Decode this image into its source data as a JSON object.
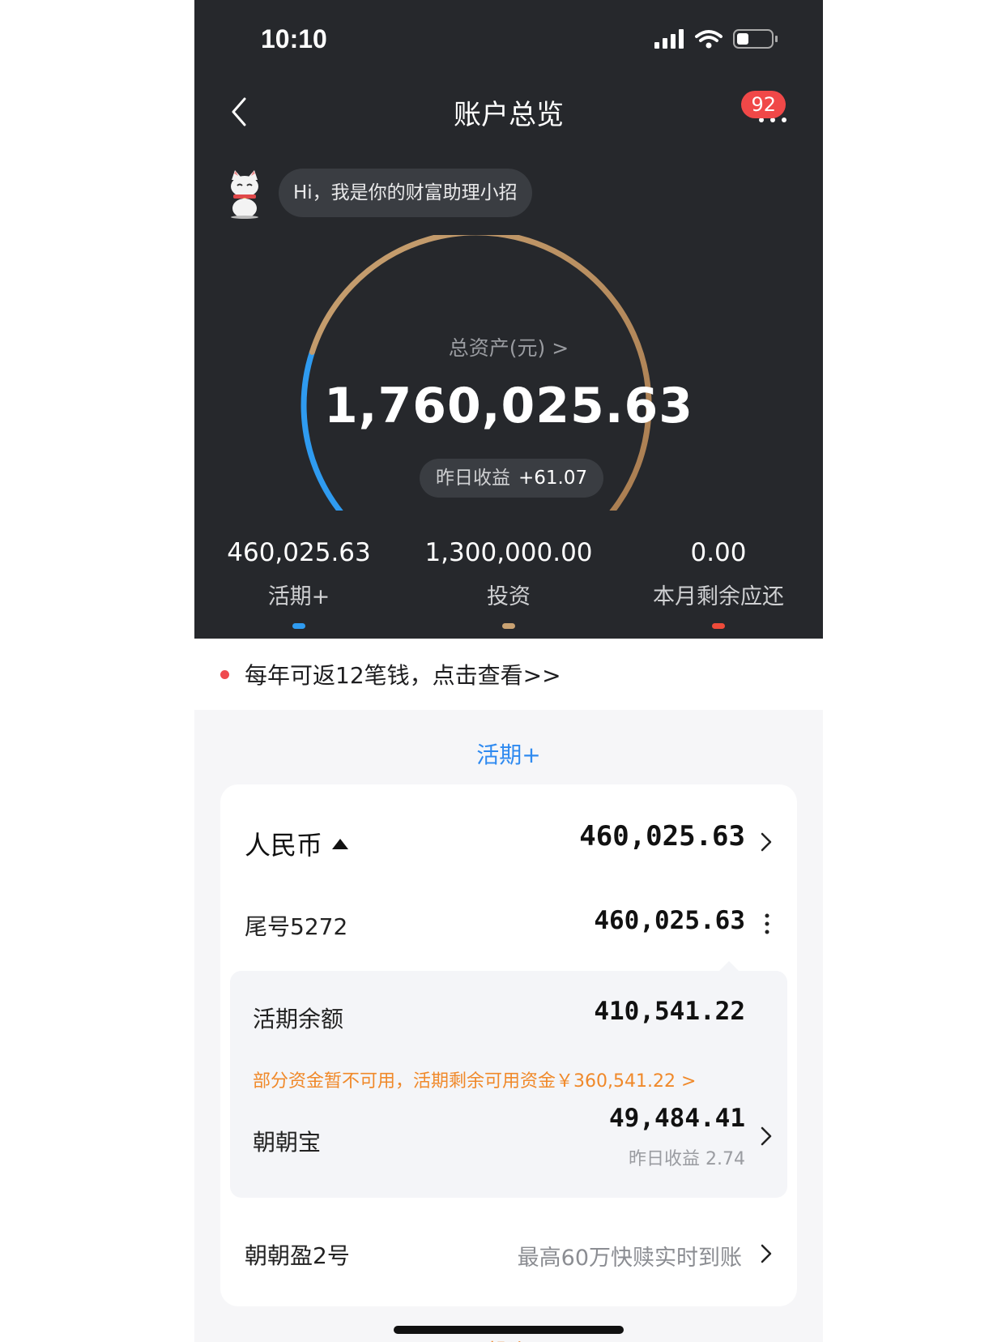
{
  "status_bar": {
    "time": "10:10"
  },
  "nav": {
    "title": "账户总览",
    "badge": "92"
  },
  "assistant": {
    "greeting": "Hi，我是你的财富助理小招"
  },
  "summary": {
    "total_label": "总资产(元) >",
    "total_value": "1,760,025.63",
    "yesterday_label": "昨日收益",
    "yesterday_value": "+61.07",
    "gauge_blue_fraction": 0.2614,
    "gauge_gold_fraction": 0.7386
  },
  "stats": [
    {
      "value": "460,025.63",
      "label": "活期+",
      "color": "#2f9bf0"
    },
    {
      "value": "1,300,000.00",
      "label": "投资",
      "color": "#c9a272"
    },
    {
      "value": "0.00",
      "label": "本月剩余应还",
      "color": "#ee4b3a"
    }
  ],
  "notice": {
    "text": "每年可返12笔钱，点击查看>>"
  },
  "section": {
    "title": "活期+"
  },
  "currency": {
    "name": "人民币",
    "amount": "460,025.63"
  },
  "account": {
    "name": "尾号5272",
    "amount": "460,025.63"
  },
  "detail": {
    "balance_label": "活期余额",
    "balance_value": "410,541.22",
    "warning": "部分资金暂不可用，活期剩余可用资金￥360,541.22 >",
    "product_name": "朝朝宝",
    "product_amount": "49,484.41",
    "product_yesterday": "昨日收益 2.74"
  },
  "product2": {
    "name": "朝朝盈2号",
    "desc": "最高60万快赎实时到账"
  },
  "peek_text": "投资",
  "colors": {
    "dark_bg": "#26282c",
    "accent_blue": "#2f8af0",
    "gold": "#c9a272",
    "warning_orange": "#f0892a",
    "badge_red": "#f04848"
  }
}
